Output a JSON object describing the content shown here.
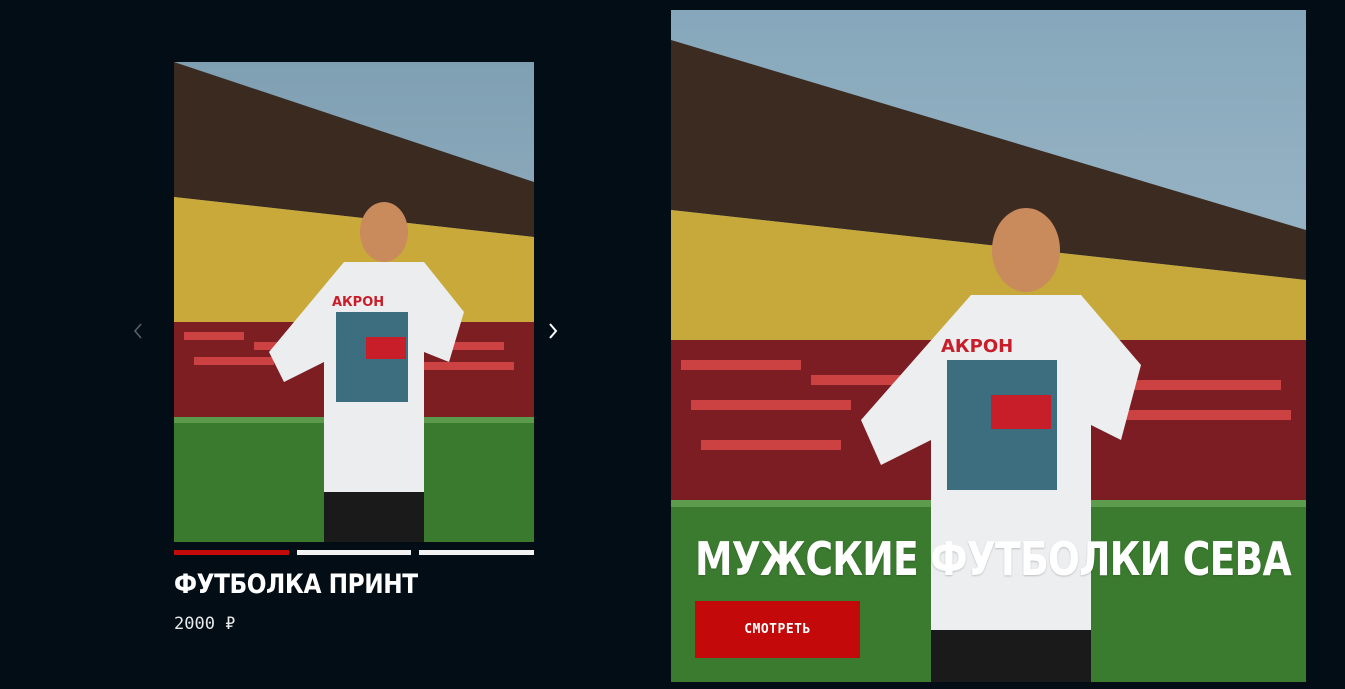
{
  "product": {
    "title": "Футболка принт",
    "price": "2000 ₽",
    "print_text": "АКРОН",
    "gallery_count": 3,
    "active_slide": 1
  },
  "nav": {
    "prev_icon": "chevron-left-icon",
    "next_icon": "chevron-right-icon"
  },
  "banner": {
    "title": "Мужские футболки Сева",
    "cta_label": "смотреть",
    "print_text": "АКРОН"
  },
  "colors": {
    "background": "#020d16",
    "accent": "#c4090a",
    "indicator_inactive": "#f2f2f2"
  }
}
